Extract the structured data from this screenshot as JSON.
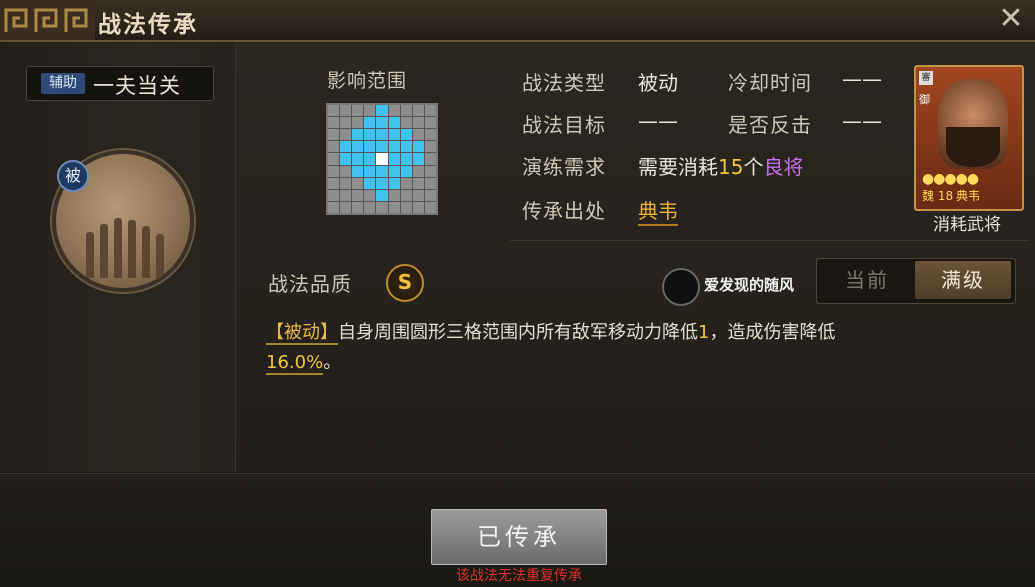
{
  "window": {
    "title": "战法传承",
    "close_icon": "close-icon"
  },
  "skill": {
    "role_tag": "辅助",
    "name": "一夫当关",
    "type_tag": "被",
    "quality_label": "战法品质",
    "quality_grade": "S"
  },
  "range": {
    "label": "影响范围",
    "grid_size": 9,
    "cells_on": [
      [
        0,
        4
      ],
      [
        1,
        3
      ],
      [
        1,
        4
      ],
      [
        1,
        5
      ],
      [
        2,
        2
      ],
      [
        2,
        3
      ],
      [
        2,
        4
      ],
      [
        2,
        5
      ],
      [
        2,
        6
      ],
      [
        3,
        1
      ],
      [
        3,
        2
      ],
      [
        3,
        3
      ],
      [
        3,
        4
      ],
      [
        3,
        5
      ],
      [
        3,
        6
      ],
      [
        3,
        7
      ],
      [
        4,
        1
      ],
      [
        4,
        2
      ],
      [
        4,
        3
      ],
      [
        4,
        5
      ],
      [
        4,
        6
      ],
      [
        4,
        7
      ],
      [
        5,
        2
      ],
      [
        5,
        3
      ],
      [
        5,
        4
      ],
      [
        5,
        5
      ],
      [
        5,
        6
      ],
      [
        6,
        3
      ],
      [
        6,
        4
      ],
      [
        6,
        5
      ],
      [
        7,
        4
      ]
    ],
    "center": [
      4,
      4
    ],
    "active_color": "#3fc3ee"
  },
  "info": {
    "type_label": "战法类型",
    "type_value": "被动",
    "cooldown_label": "冷却时间",
    "cooldown_value": "——",
    "target_label": "战法目标",
    "target_value": "——",
    "counter_label": "是否反击",
    "counter_value": "——",
    "req_label": "演练需求",
    "req_prefix": "需要消耗",
    "req_count": "15",
    "req_unit": "个",
    "req_quality": "良将",
    "source_label": "传承出处",
    "source_value": "典韦"
  },
  "card": {
    "level": "18",
    "name": "典韦",
    "stars": "●●●●●",
    "tag1": "審",
    "tag2": "御",
    "faction": "魏",
    "caption": "消耗武将"
  },
  "watermark": {
    "text": "爱发现的随风"
  },
  "level_toggle": {
    "current": "当前",
    "max": "满级"
  },
  "description": {
    "tag": "【被动】",
    "text1": "自身周围圆形三格范围内所有敌军移动力降低",
    "num1": "1",
    "text2": "，造成伤害降低",
    "num2": "16.0%",
    "text3": "。"
  },
  "footer": {
    "button_label": "已传承",
    "warning": "该战法无法重复传承"
  }
}
